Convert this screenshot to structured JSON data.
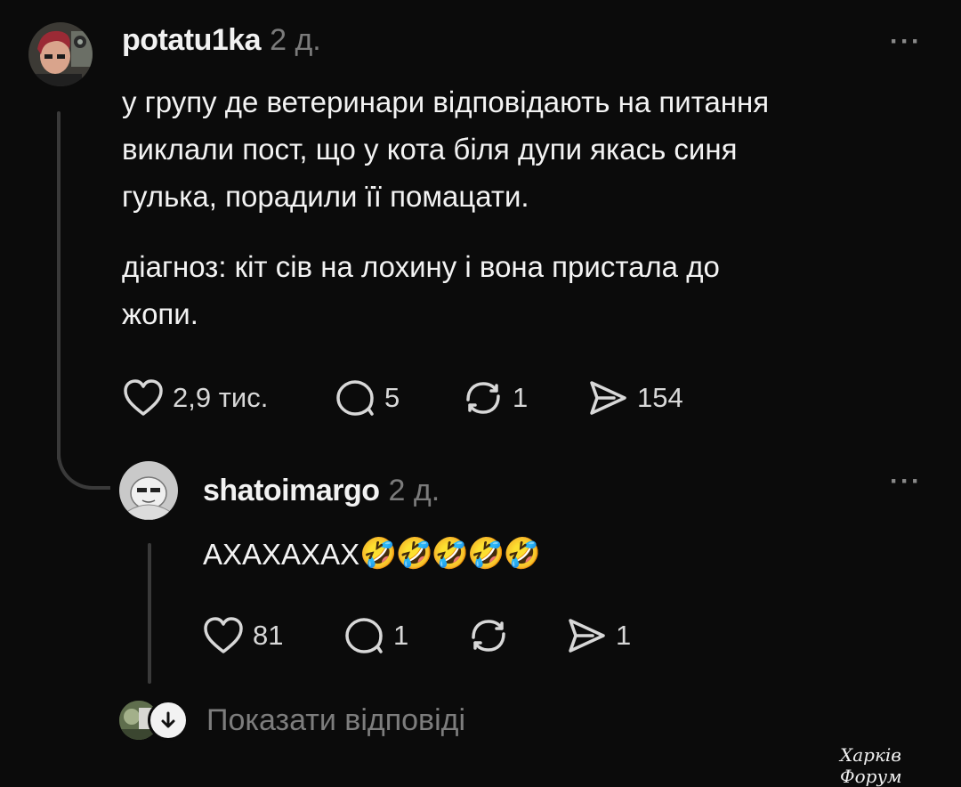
{
  "post": {
    "username": "potatu1ka",
    "time": "2 д.",
    "more": "···",
    "paragraph1_lines": [
      "у групу де ветеринари відповідають на питання",
      "виклали пост, що у кота біля дупи якась синя",
      "гулька, порадили її помацати."
    ],
    "paragraph2_lines": [
      "діагноз: кіт сів на лохину і вона пристала до",
      "жопи."
    ],
    "actions": {
      "likes": "2,9 тис.",
      "replies": "5",
      "reposts": "1",
      "shares": "154"
    }
  },
  "reply": {
    "username": "shatoimargo",
    "time": "2 д.",
    "more": "···",
    "text": "АХАХАХАХ",
    "emojis": [
      "🤣",
      "🤣",
      "🤣",
      "🤣",
      "🤣"
    ],
    "actions": {
      "likes": "81",
      "replies": "1",
      "reposts": "",
      "shares": "1"
    }
  },
  "show_replies": {
    "label": "Показати відповіді"
  },
  "watermark": "Харків Форум",
  "colors": {
    "background": "#0b0b0b",
    "text": "#f2f2f2",
    "muted": "#7b7b7b",
    "thread_line": "#3a3a3a"
  },
  "icons": [
    "heart-icon",
    "comment-icon",
    "repost-icon",
    "share-icon",
    "more-icon",
    "arrow-down-icon"
  ]
}
